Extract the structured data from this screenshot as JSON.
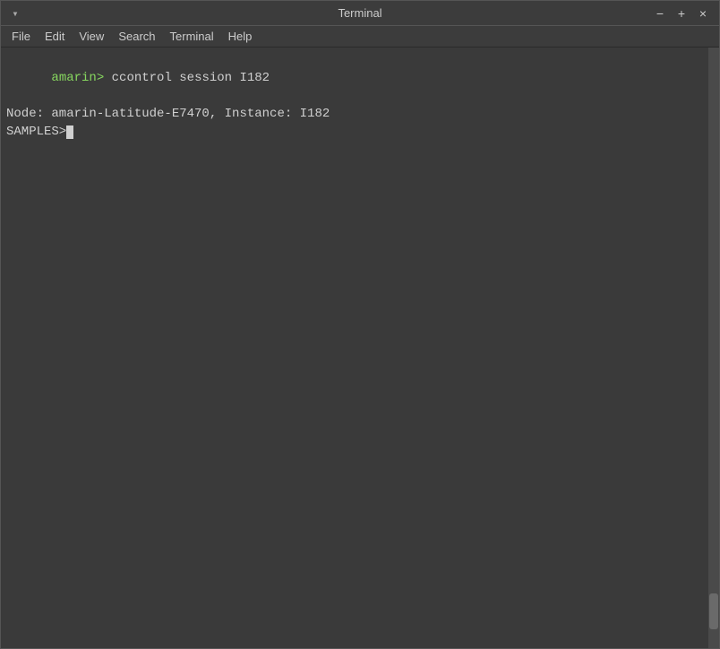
{
  "window": {
    "title": "Terminal"
  },
  "titlebar": {
    "minimize_label": "−",
    "maximize_label": "+",
    "close_label": "×",
    "icon": "▾"
  },
  "menubar": {
    "items": [
      {
        "label": "File"
      },
      {
        "label": "Edit"
      },
      {
        "label": "View"
      },
      {
        "label": "Search"
      },
      {
        "label": "Terminal"
      },
      {
        "label": "Help"
      }
    ]
  },
  "terminal": {
    "line1_user": "amarin",
    "line1_prompt": ">",
    "line1_command": " ccontrol session I182",
    "line2": "Node: amarin-Latitude-E7470, Instance: I182",
    "line3_prompt": "SAMPLES>"
  }
}
